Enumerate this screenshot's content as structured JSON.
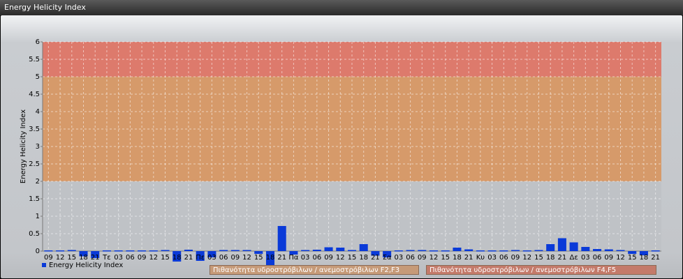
{
  "window": {
    "title": "Energy Helicity Index"
  },
  "colors": {
    "zone_high": "#dd7a6c",
    "zone_mid": "#d69a6a",
    "zone_low": "#bfc2c6",
    "bar": "#0a3ad8",
    "legend1_bg": "#c69a78",
    "legend2_bg": "#c47a6a"
  },
  "legend": {
    "series_label": "Energy Helicity Index",
    "zone_labels": [
      "Πιθανότητα υδροστρόβιλων / ανεμοστρόβιλων F2,F3",
      "Πιθανότητα υδροστρόβιλων / ανεμοστρόβιλων F4,F5"
    ]
  },
  "chart_data": {
    "type": "bar",
    "ylabel": "Energy Helicity Index",
    "ylim": [
      0,
      6
    ],
    "yticks": [
      "0",
      "0.5",
      "1",
      "1.5",
      "2",
      "2.5",
      "3",
      "3.5",
      "4",
      "4.5",
      "5",
      "5.5",
      "6"
    ],
    "grid": true,
    "bands": [
      {
        "from": 2,
        "to": 5
      },
      {
        "from": 5,
        "to": 6
      }
    ],
    "categories": [
      "09",
      "12",
      "15",
      "18",
      "21",
      "Τε",
      "03",
      "06",
      "09",
      "12",
      "15",
      "18",
      "21",
      "Πε",
      "03",
      "06",
      "09",
      "12",
      "15",
      "18",
      "21",
      "Πα",
      "03",
      "06",
      "09",
      "12",
      "15",
      "18",
      "21",
      "Σα",
      "03",
      "06",
      "09",
      "12",
      "15",
      "18",
      "21",
      "Κυ",
      "03",
      "06",
      "09",
      "12",
      "15",
      "18",
      "21",
      "Δε",
      "03",
      "06",
      "09",
      "12",
      "15",
      "18",
      "21"
    ],
    "values": [
      0.02,
      0.02,
      0.03,
      -0.15,
      -0.2,
      0.02,
      0.02,
      0.02,
      0.02,
      0.02,
      0.03,
      -0.3,
      0.04,
      -0.28,
      -0.18,
      0.03,
      0.03,
      0.03,
      -0.08,
      -0.45,
      0.72,
      -0.1,
      0.03,
      0.04,
      0.11,
      0.1,
      0.03,
      0.2,
      -0.13,
      -0.18,
      0.02,
      0.03,
      0.03,
      0.02,
      0.02,
      0.1,
      0.05,
      0.02,
      0.02,
      0.02,
      0.03,
      0.02,
      0.03,
      0.2,
      0.37,
      0.25,
      0.12,
      0.06,
      0.05,
      0.03,
      -0.08,
      -0.12,
      0.02
    ]
  }
}
